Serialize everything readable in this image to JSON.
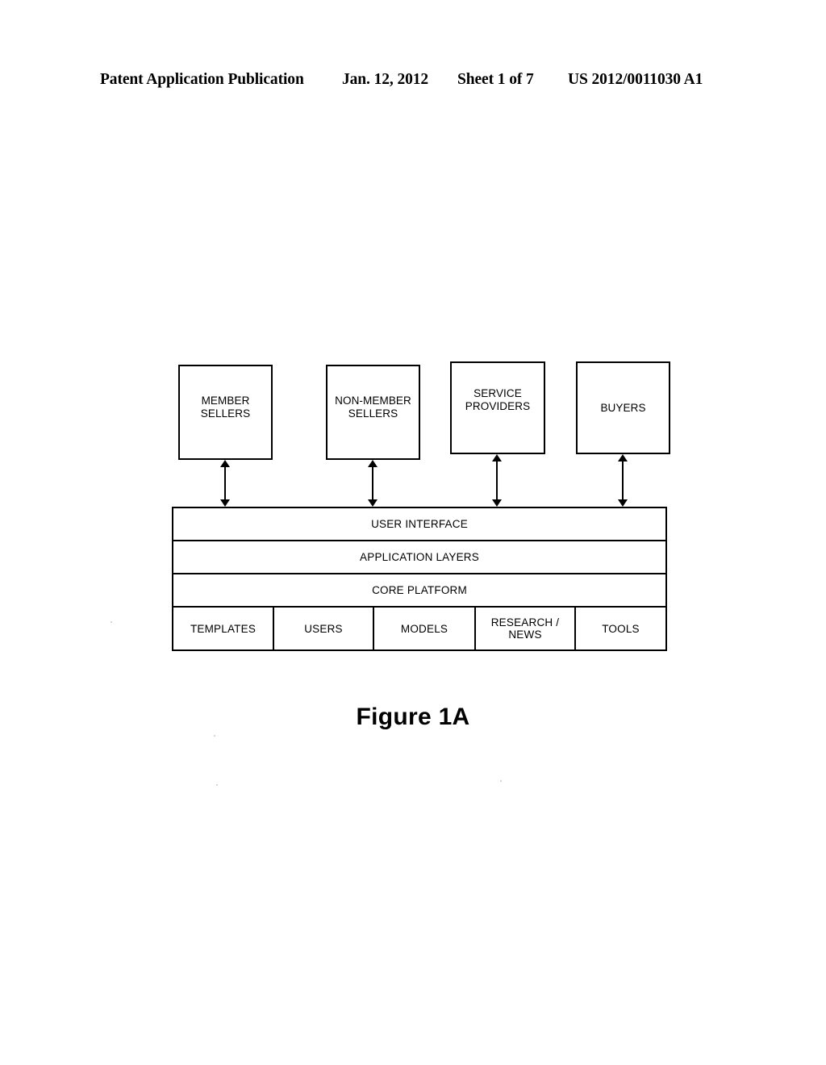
{
  "header": {
    "publication": "Patent Application Publication",
    "date": "Jan. 12, 2012",
    "sheet": "Sheet 1 of 7",
    "publication_number": "US 2012/0011030 A1"
  },
  "figure": {
    "caption": "Figure 1A",
    "actors": [
      {
        "id": "member-sellers",
        "label": "MEMBER\nSELLERS"
      },
      {
        "id": "non-member-sellers",
        "label": "NON-MEMBER\nSELLERS"
      },
      {
        "id": "service-providers",
        "label": "SERVICE\nPROVIDERS"
      },
      {
        "id": "buyers",
        "label": "BUYERS"
      }
    ],
    "connectors": [
      {
        "id": "connector-member-sellers",
        "type": "double-arrow-vertical",
        "from": "MEMBER SELLERS",
        "to": "USER INTERFACE"
      },
      {
        "id": "connector-non-member-sellers",
        "type": "double-arrow-vertical",
        "from": "NON-MEMBER SELLERS",
        "to": "USER INTERFACE"
      },
      {
        "id": "connector-service-providers",
        "type": "double-arrow-vertical",
        "from": "SERVICE PROVIDERS",
        "to": "USER INTERFACE"
      },
      {
        "id": "connector-buyers",
        "type": "double-arrow-vertical",
        "from": "BUYERS",
        "to": "USER INTERFACE"
      }
    ],
    "stack": {
      "layers": [
        {
          "id": "user-interface",
          "label": "USER INTERFACE"
        },
        {
          "id": "application-layers",
          "label": "APPLICATION LAYERS"
        },
        {
          "id": "core-platform",
          "label": "CORE PLATFORM"
        }
      ],
      "components": [
        {
          "id": "templates",
          "label": "TEMPLATES"
        },
        {
          "id": "users",
          "label": "USERS"
        },
        {
          "id": "models",
          "label": "MODELS"
        },
        {
          "id": "research-news",
          "label": "RESEARCH /\nNEWS"
        },
        {
          "id": "tools",
          "label": "TOOLS"
        }
      ]
    }
  },
  "colors": {
    "ink": "#000000",
    "page": "#ffffff"
  }
}
